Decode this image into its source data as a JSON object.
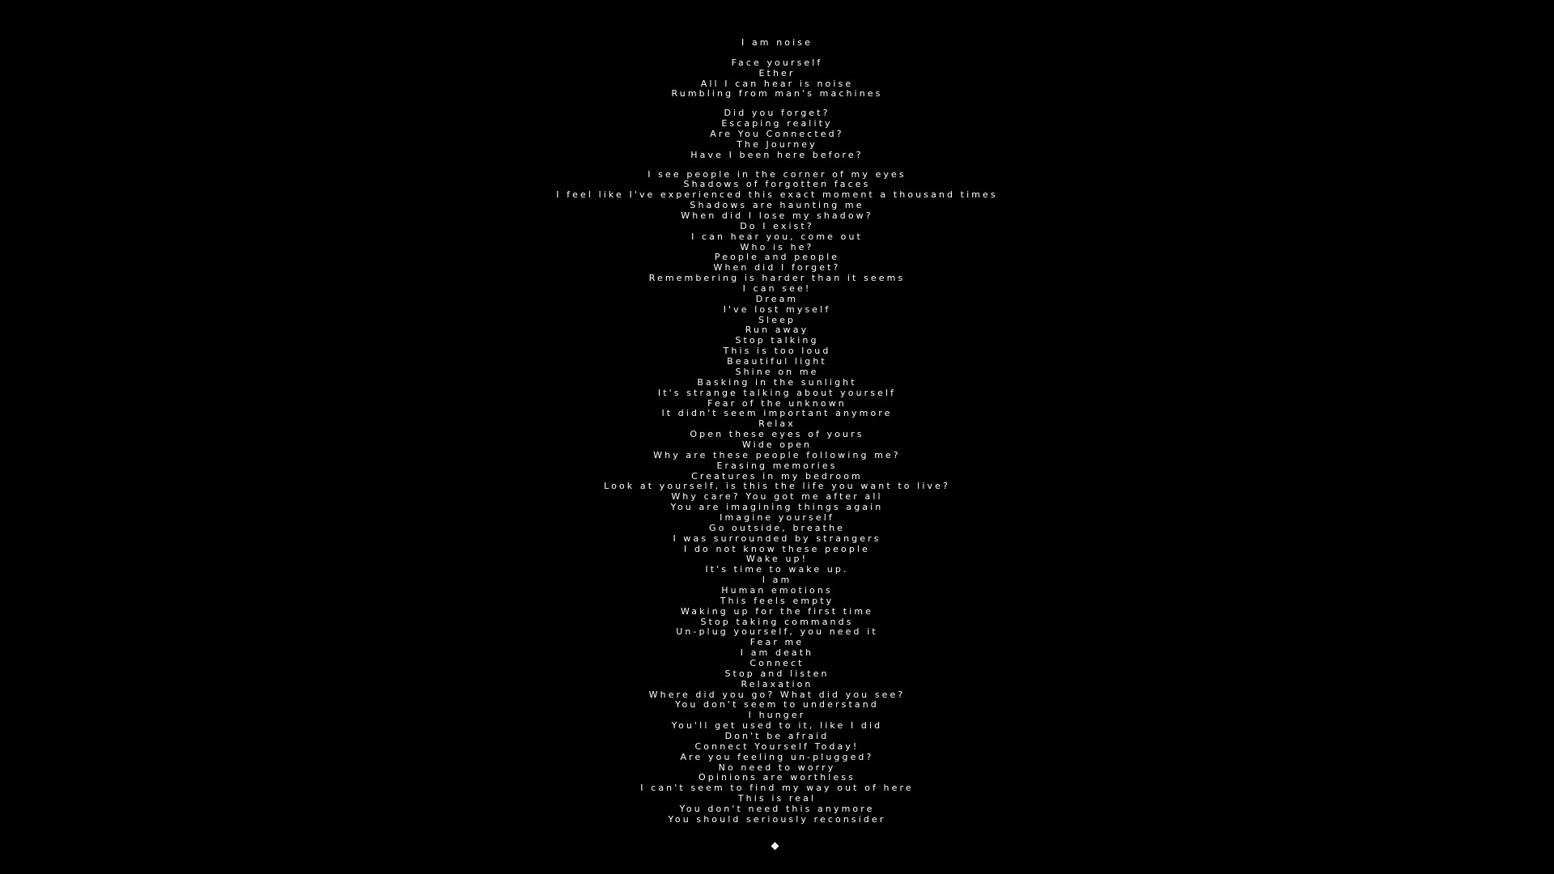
{
  "colors": {
    "background": "#000000",
    "text": "#ffffff"
  },
  "icons": {
    "cursor": "diamond-cursor-icon"
  },
  "groups": [
    [
      "I am noise"
    ],
    [
      "Face yourself",
      "Ether",
      "All I can hear is noise",
      "Rumbling from man's machines"
    ],
    [
      "Did you forget?",
      "Escaping reality",
      "Are You Connected?",
      "The Journey",
      "Have I been here before?"
    ],
    [
      "I see people in the corner of my eyes",
      "Shadows of forgotten faces",
      "I feel like I've experienced this exact moment a thousand times",
      "Shadows are haunting me",
      "When did I lose my shadow?",
      "Do I exist?",
      "I can hear you, come out",
      "Who is he?",
      "People and people",
      "When did I forget?",
      "Remembering is harder than it seems",
      "I can see!",
      "Dream",
      "I've lost myself",
      "Sleep",
      "Run away",
      "Stop talking",
      "This is too loud",
      "Beautiful light",
      "Shine on me",
      "Basking in the sunlight",
      "It's strange talking about yourself",
      "Fear of the unknown",
      "It didn't seem important anymore",
      "Relax",
      "Open these eyes of yours",
      "Wide open",
      "Why are these people following me?",
      "Erasing memories",
      "Creatures in my bedroom",
      "Look at yourself, is this the life you want to live?",
      "Why care? You got me after all",
      "You are imagining things again",
      "Imagine yourself",
      "Go outside, breathe",
      "I was surrounded by strangers",
      "I do not know these people",
      "Wake up!",
      "It's time to wake up.",
      "I am",
      "Human emotions",
      "This feels empty",
      "Waking up for the first time",
      "Stop taking commands",
      "Un-plug yourself, you need it",
      "Fear me",
      "I am death",
      "Connect",
      "Stop and listen",
      "Relaxation",
      "Where did you go? What did you see?",
      "You don't seem to understand",
      "I hunger",
      "You'll get used to it, like I did",
      "Don't be afraid",
      "Connect Yourself Today!",
      "Are you feeling un-plugged?",
      "No need to worry",
      "Opinions are worthless",
      "I can't seem to find my way out of here",
      "This is real",
      "You don't need this anymore",
      "You should seriously reconsider"
    ]
  ]
}
